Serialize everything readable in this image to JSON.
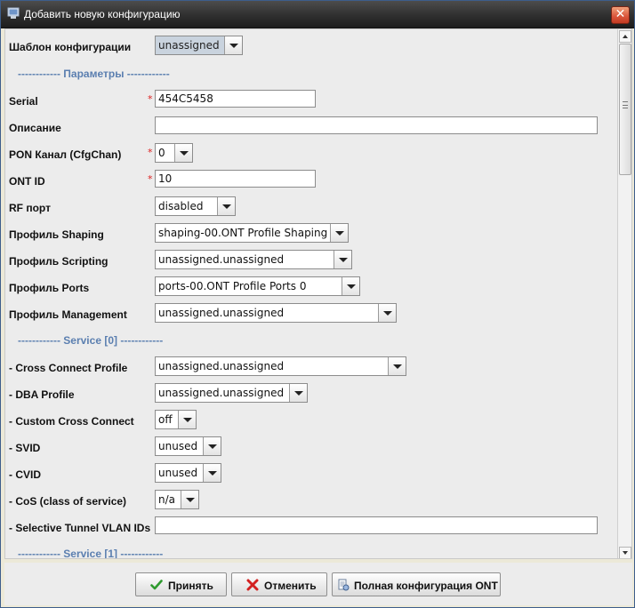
{
  "window": {
    "title": "Добавить новую конфигурацию",
    "icon": "window-config-icon",
    "close_label": "✕"
  },
  "form": {
    "template": {
      "label": "Шаблон конфигурации",
      "value": "unassigned"
    },
    "section_params": "------------ Параметры ------------",
    "serial": {
      "label": "Serial",
      "value": "454C5458",
      "required": "*"
    },
    "description": {
      "label": "Описание",
      "value": ""
    },
    "pon_channel": {
      "label": "PON Канал (CfgChan)",
      "value": "0",
      "required": "*"
    },
    "ont_id": {
      "label": "ONT ID",
      "value": "10",
      "required": "*"
    },
    "rf_port": {
      "label": "RF порт",
      "value": "disabled"
    },
    "shaping": {
      "label": "Профиль Shaping",
      "value": "shaping-00.ONT Profile Shaping 0"
    },
    "scripting": {
      "label": "Профиль Scripting",
      "value": "unassigned.unassigned"
    },
    "ports": {
      "label": "Профиль Ports",
      "value": "ports-00.ONT Profile Ports 0"
    },
    "management": {
      "label": "Профиль Management",
      "value": "unassigned.unassigned"
    },
    "section_service0": "------------ Service [0] ------------",
    "cross_connect": {
      "label": "- Cross Connect Profile",
      "value": "unassigned.unassigned"
    },
    "dba": {
      "label": "- DBA Profile",
      "value": "unassigned.unassigned"
    },
    "custom_cc": {
      "label": "- Custom Cross Connect",
      "value": "off"
    },
    "svid": {
      "label": "- SVID",
      "value": "unused"
    },
    "cvid": {
      "label": "- CVID",
      "value": "unused"
    },
    "cos": {
      "label": "- CoS (class of service)",
      "value": "n/a"
    },
    "selective_tunnel": {
      "label": "- Selective Tunnel VLAN IDs",
      "value": ""
    },
    "section_service1": "------------ Service [1] ------------"
  },
  "buttons": {
    "accept": "Принять",
    "cancel": "Отменить",
    "full_config": "Полная конфигурация ONT"
  },
  "colors": {
    "section": "#5b7fb0",
    "required": "#dd2222",
    "accept_icon": "#2e9a2e",
    "cancel_icon": "#d32020"
  }
}
